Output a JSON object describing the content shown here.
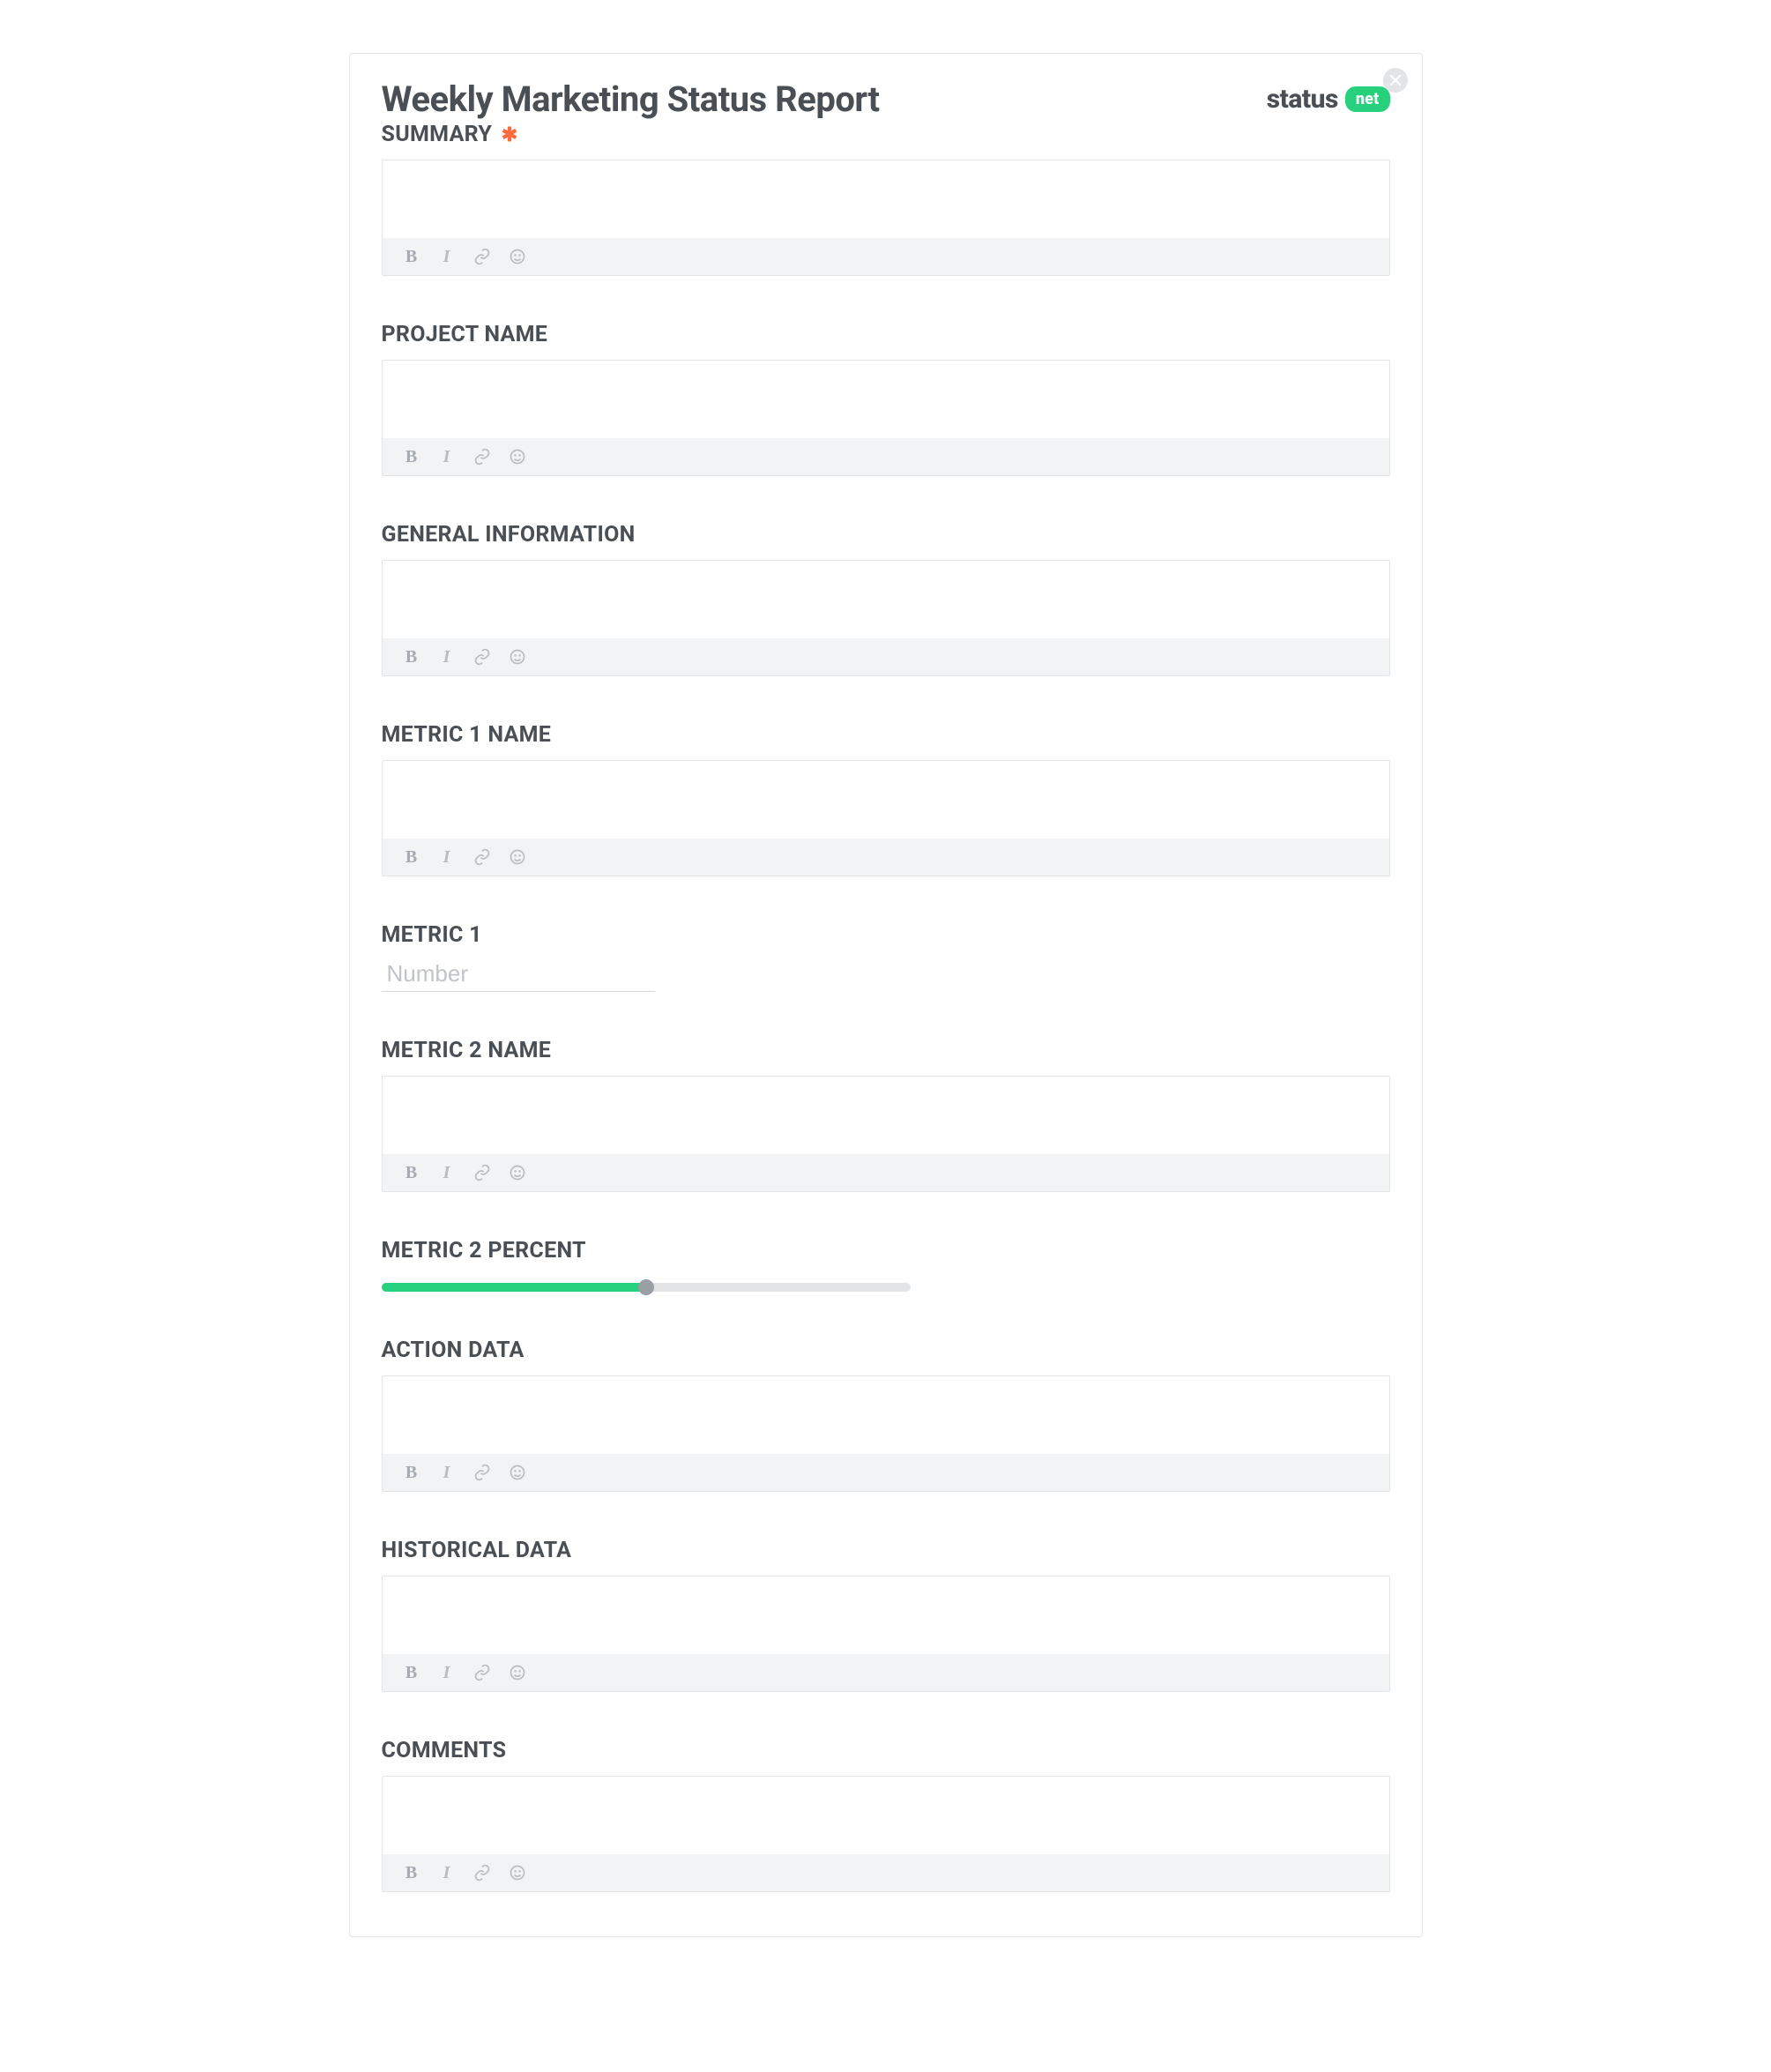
{
  "header": {
    "title": "Weekly Marketing Status Report",
    "brand_text": "status",
    "brand_badge": "net"
  },
  "sections": {
    "summary": {
      "label": "SUMMARY",
      "required": true
    },
    "project_name": {
      "label": "PROJECT NAME"
    },
    "general_info": {
      "label": "GENERAL INFORMATION"
    },
    "metric1_name": {
      "label": "METRIC 1 NAME"
    },
    "metric1": {
      "label": "METRIC 1",
      "placeholder": "Number"
    },
    "metric2_name": {
      "label": "METRIC 2 NAME"
    },
    "metric2_percent": {
      "label": "METRIC 2 PERCENT",
      "value_percent": 50
    },
    "action_data": {
      "label": "ACTION DATA"
    },
    "historical_data": {
      "label": "HISTORICAL DATA"
    },
    "comments": {
      "label": "COMMENTS"
    }
  },
  "toolbar": {
    "bold": "B",
    "italic": "I"
  }
}
